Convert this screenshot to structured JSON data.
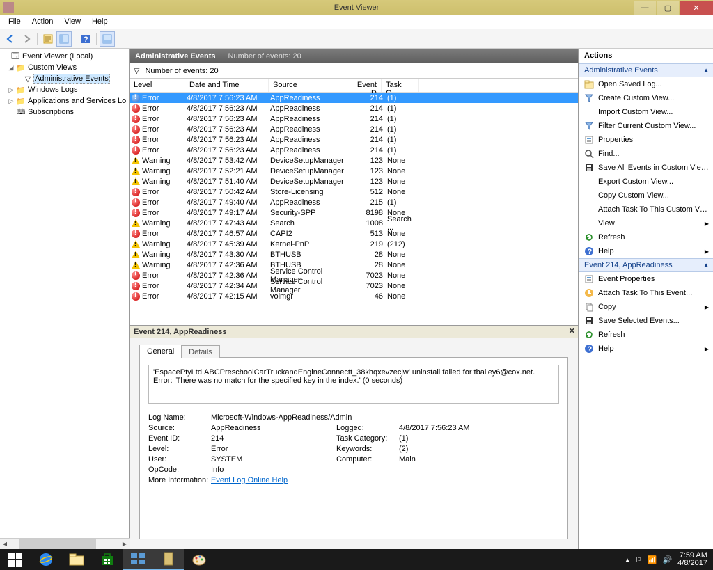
{
  "titlebar": {
    "title": "Event Viewer"
  },
  "menu": {
    "file": "File",
    "action": "Action",
    "view": "View",
    "help": "Help"
  },
  "tree": {
    "root": "Event Viewer (Local)",
    "custom": "Custom Views",
    "admin": "Administrative Events",
    "winlogs": "Windows Logs",
    "appsvc": "Applications and Services Lo",
    "subs": "Subscriptions"
  },
  "center": {
    "heading": "Administrative Events",
    "count_label": "Number of events: 20",
    "filter_label": "Number of events: 20",
    "cols": {
      "level": "Level",
      "date": "Date and Time",
      "source": "Source",
      "eid": "Event ID",
      "tc": "Task C..."
    },
    "rows": [
      {
        "icon": "info",
        "level": "Error",
        "date": "4/8/2017 7:56:23 AM",
        "source": "AppReadiness",
        "eid": "214",
        "tc": "(1)",
        "sel": true
      },
      {
        "icon": "err",
        "level": "Error",
        "date": "4/8/2017 7:56:23 AM",
        "source": "AppReadiness",
        "eid": "214",
        "tc": "(1)"
      },
      {
        "icon": "err",
        "level": "Error",
        "date": "4/8/2017 7:56:23 AM",
        "source": "AppReadiness",
        "eid": "214",
        "tc": "(1)"
      },
      {
        "icon": "err",
        "level": "Error",
        "date": "4/8/2017 7:56:23 AM",
        "source": "AppReadiness",
        "eid": "214",
        "tc": "(1)"
      },
      {
        "icon": "err",
        "level": "Error",
        "date": "4/8/2017 7:56:23 AM",
        "source": "AppReadiness",
        "eid": "214",
        "tc": "(1)"
      },
      {
        "icon": "err",
        "level": "Error",
        "date": "4/8/2017 7:56:23 AM",
        "source": "AppReadiness",
        "eid": "214",
        "tc": "(1)"
      },
      {
        "icon": "warn",
        "level": "Warning",
        "date": "4/8/2017 7:53:42 AM",
        "source": "DeviceSetupManager",
        "eid": "123",
        "tc": "None"
      },
      {
        "icon": "warn",
        "level": "Warning",
        "date": "4/8/2017 7:52:21 AM",
        "source": "DeviceSetupManager",
        "eid": "123",
        "tc": "None"
      },
      {
        "icon": "warn",
        "level": "Warning",
        "date": "4/8/2017 7:51:40 AM",
        "source": "DeviceSetupManager",
        "eid": "123",
        "tc": "None"
      },
      {
        "icon": "err",
        "level": "Error",
        "date": "4/8/2017 7:50:42 AM",
        "source": "Store-Licensing",
        "eid": "512",
        "tc": "None"
      },
      {
        "icon": "err",
        "level": "Error",
        "date": "4/8/2017 7:49:40 AM",
        "source": "AppReadiness",
        "eid": "215",
        "tc": "(1)"
      },
      {
        "icon": "err",
        "level": "Error",
        "date": "4/8/2017 7:49:17 AM",
        "source": "Security-SPP",
        "eid": "8198",
        "tc": "None"
      },
      {
        "icon": "warn",
        "level": "Warning",
        "date": "4/8/2017 7:47:43 AM",
        "source": "Search",
        "eid": "1008",
        "tc": "Search ..."
      },
      {
        "icon": "err",
        "level": "Error",
        "date": "4/8/2017 7:46:57 AM",
        "source": "CAPI2",
        "eid": "513",
        "tc": "None"
      },
      {
        "icon": "warn",
        "level": "Warning",
        "date": "4/8/2017 7:45:39 AM",
        "source": "Kernel-PnP",
        "eid": "219",
        "tc": "(212)"
      },
      {
        "icon": "warn",
        "level": "Warning",
        "date": "4/8/2017 7:43:30 AM",
        "source": "BTHUSB",
        "eid": "28",
        "tc": "None"
      },
      {
        "icon": "warn",
        "level": "Warning",
        "date": "4/8/2017 7:42:36 AM",
        "source": "BTHUSB",
        "eid": "28",
        "tc": "None"
      },
      {
        "icon": "err",
        "level": "Error",
        "date": "4/8/2017 7:42:36 AM",
        "source": "Service Control Manager",
        "eid": "7023",
        "tc": "None"
      },
      {
        "icon": "err",
        "level": "Error",
        "date": "4/8/2017 7:42:34 AM",
        "source": "Service Control Manager",
        "eid": "7023",
        "tc": "None"
      },
      {
        "icon": "err",
        "level": "Error",
        "date": "4/8/2017 7:42:15 AM",
        "source": "volmgr",
        "eid": "46",
        "tc": "None"
      }
    ]
  },
  "detail": {
    "title": "Event 214, AppReadiness",
    "tab_general": "General",
    "tab_details": "Details",
    "message": "'EspacePtyLtd.ABCPreschoolCarTruckandEngineConnectt_38khqxevzecjw' uninstall failed for tbailey6@cox.net. Error: 'There was no match for the specified key in the index.' (0 seconds)",
    "k_logname": "Log Name:",
    "v_logname": "Microsoft-Windows-AppReadiness/Admin",
    "k_source": "Source:",
    "v_source": "AppReadiness",
    "k_logged": "Logged:",
    "v_logged": "4/8/2017 7:56:23 AM",
    "k_eid": "Event ID:",
    "v_eid": "214",
    "k_tc": "Task Category:",
    "v_tc": "(1)",
    "k_level": "Level:",
    "v_level": "Error",
    "k_kw": "Keywords:",
    "v_kw": "(2)",
    "k_user": "User:",
    "v_user": "SYSTEM",
    "k_comp": "Computer:",
    "v_comp": "Main",
    "k_op": "OpCode:",
    "v_op": "Info",
    "k_more": "More Information:",
    "v_more": "Event Log Online Help"
  },
  "right": {
    "heading": "Actions",
    "sec1": "Administrative Events",
    "items1": [
      {
        "icon": "open",
        "label": "Open Saved Log..."
      },
      {
        "icon": "filter",
        "label": "Create Custom View..."
      },
      {
        "icon": "",
        "label": "Import Custom View..."
      },
      {
        "icon": "filter",
        "label": "Filter Current Custom View..."
      },
      {
        "icon": "props",
        "label": "Properties"
      },
      {
        "icon": "find",
        "label": "Find..."
      },
      {
        "icon": "save",
        "label": "Save All Events in Custom View ..."
      },
      {
        "icon": "",
        "label": "Export Custom View..."
      },
      {
        "icon": "",
        "label": "Copy Custom View..."
      },
      {
        "icon": "",
        "label": "Attach Task To This Custom Vie..."
      },
      {
        "icon": "",
        "label": "View",
        "sub": true
      },
      {
        "icon": "refresh",
        "label": "Refresh"
      },
      {
        "icon": "help",
        "label": "Help",
        "sub": true
      }
    ],
    "sec2": "Event 214, AppReadiness",
    "items2": [
      {
        "icon": "props",
        "label": "Event Properties"
      },
      {
        "icon": "task",
        "label": "Attach Task To This Event..."
      },
      {
        "icon": "copy",
        "label": "Copy",
        "sub": true
      },
      {
        "icon": "save",
        "label": "Save Selected Events..."
      },
      {
        "icon": "refresh",
        "label": "Refresh"
      },
      {
        "icon": "help",
        "label": "Help",
        "sub": true
      }
    ]
  },
  "taskbar": {
    "time": "7:59 AM",
    "date": "4/8/2017"
  }
}
